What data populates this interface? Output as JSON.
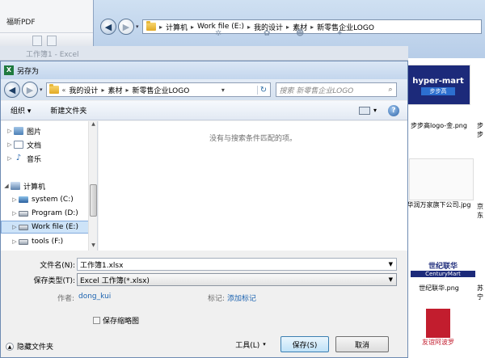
{
  "pdf_window": {
    "title": "福昕PDF"
  },
  "explorer": {
    "breadcrumb": [
      "计算机",
      "Work file (E:)",
      "我的设计",
      "素材",
      "新零售企业LOGO"
    ],
    "files": [
      {
        "label": "hyper-mart",
        "sub": "步步高"
      },
      {
        "label": "步步高logo-金.png"
      },
      {
        "label": "步步"
      },
      {
        "label": "华润万家旗下公司.jpg"
      },
      {
        "label": "京东"
      },
      {
        "label": "世纪联华.png"
      },
      {
        "label": "苏宁"
      },
      {
        "label": "世纪联华",
        "sub": "CenturyMart"
      },
      {
        "label": "友谊阿波罗"
      }
    ]
  },
  "excel": {
    "title": "工作簿1 - Excel"
  },
  "dialog": {
    "title": "另存为",
    "breadcrumb": [
      "我的设计",
      "素材",
      "新零售企业LOGO"
    ],
    "search_placeholder": "搜索 新零售企业LOGO",
    "organize_label": "组织 ▾",
    "new_folder_label": "新建文件夹",
    "tree": [
      {
        "label": "图片",
        "icon": "pictures-icon"
      },
      {
        "label": "文档",
        "icon": "documents-icon"
      },
      {
        "label": "音乐",
        "icon": "music-icon"
      },
      {
        "label": "计算机",
        "icon": "computer-icon"
      },
      {
        "label": "system (C:)",
        "icon": "drive-c-icon"
      },
      {
        "label": "Program (D:)",
        "icon": "drive-icon"
      },
      {
        "label": "Work file (E:)",
        "icon": "drive-icon",
        "selected": true
      },
      {
        "label": "tools (F:)",
        "icon": "drive-icon"
      }
    ],
    "empty_message": "没有与搜索条件匹配的项。",
    "filename_label": "文件名(N):",
    "filename_value": "工作簿1.xlsx",
    "filetype_label": "保存类型(T):",
    "filetype_value": "Excel 工作簿(*.xlsx)",
    "author_label": "作者:",
    "author_value": "dong_kui",
    "tags_label": "标记:",
    "tags_value": "添加标记",
    "thumbnail_label": "保存缩略图",
    "hide_folders_label": "隐藏文件夹",
    "tools_label": "工具(L)",
    "save_label": "保存(S)",
    "cancel_label": "取消"
  }
}
